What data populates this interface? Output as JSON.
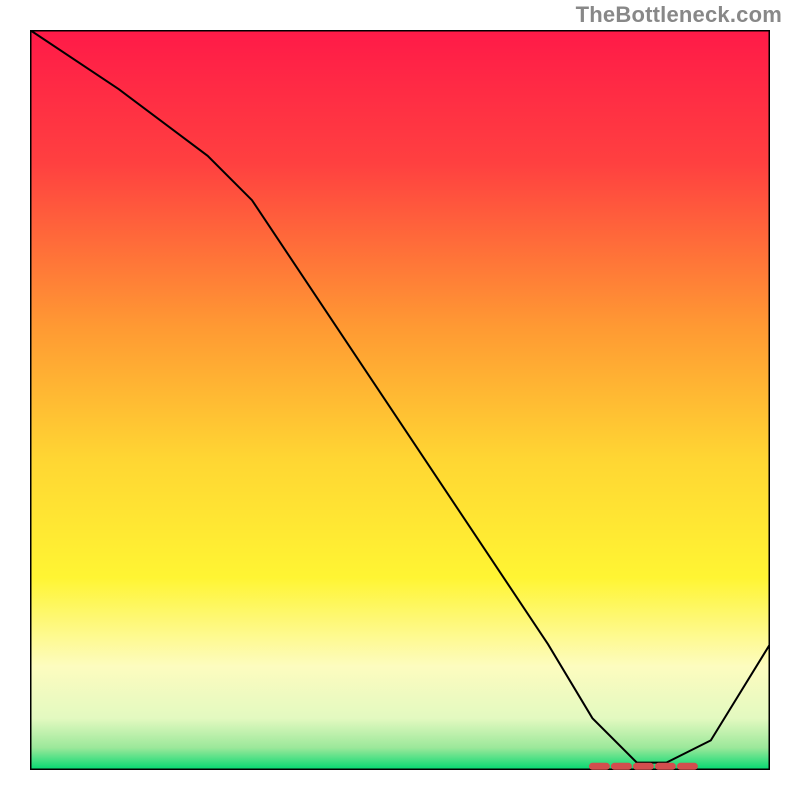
{
  "watermark": "TheBottleneck.com",
  "chart_data": {
    "type": "line",
    "title": "",
    "xlabel": "",
    "ylabel": "",
    "xlim": [
      0,
      100
    ],
    "ylim": [
      0,
      100
    ],
    "grid": false,
    "axes_visible": false,
    "background_gradient": {
      "top": "#ff1744",
      "mid_top": "#ff9933",
      "mid": "#ffe438",
      "mid_low": "#fdfccf",
      "low": "#00e676"
    },
    "series": [
      {
        "name": "bottleneck-curve",
        "x": [
          0,
          12,
          24,
          30,
          40,
          50,
          60,
          70,
          76,
          82,
          86,
          92,
          100
        ],
        "values": [
          100,
          92,
          83,
          77,
          62,
          47,
          32,
          17,
          7,
          1,
          1,
          4,
          17
        ],
        "stroke": "#000000",
        "stroke_width": 2
      }
    ],
    "markers": [
      {
        "name": "optimal-range-dashes",
        "x_start": 76,
        "x_end": 90,
        "y": 0.5,
        "stroke": "#d24e4e",
        "pattern": "dashed"
      }
    ]
  }
}
